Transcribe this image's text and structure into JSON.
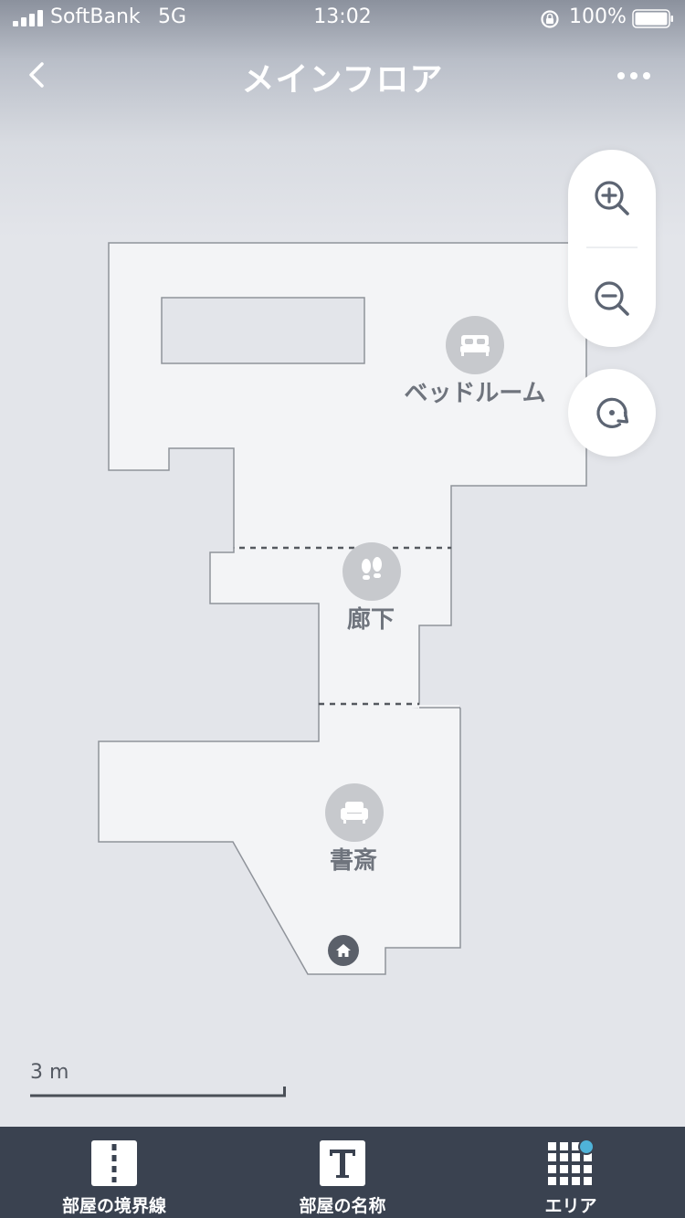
{
  "status_bar": {
    "carrier": "SoftBank",
    "network": "5G",
    "time": "13:02",
    "battery_percent": "100%"
  },
  "nav": {
    "title": "メインフロア",
    "back_icon": "chevron-left-icon",
    "more_icon": "ellipsis-icon"
  },
  "map": {
    "rooms": [
      {
        "name": "ベッドルーム",
        "icon": "bed-icon"
      },
      {
        "name": "廊下",
        "icon": "footprints-icon"
      },
      {
        "name": "書斎",
        "icon": "armchair-icon"
      }
    ],
    "dock_icon": "home-icon"
  },
  "controls": {
    "zoom_in_icon": "zoom-in-icon",
    "zoom_out_icon": "zoom-out-icon",
    "rotate_icon": "rotate-icon"
  },
  "scale": {
    "label": "3 m"
  },
  "toolbar": {
    "items": [
      {
        "label": "部屋の境界線",
        "icon": "divider-icon"
      },
      {
        "label": "部屋の名称",
        "icon": "text-icon"
      },
      {
        "label": "エリア",
        "icon": "grid-icon",
        "badge_color": "#4fb3d9"
      }
    ]
  },
  "colors": {
    "floor_fill": "#f3f4f6",
    "floor_stroke": "#8f939a",
    "toolbar_bg": "#3a4250",
    "room_icon_bg": "#c7c9cd"
  }
}
